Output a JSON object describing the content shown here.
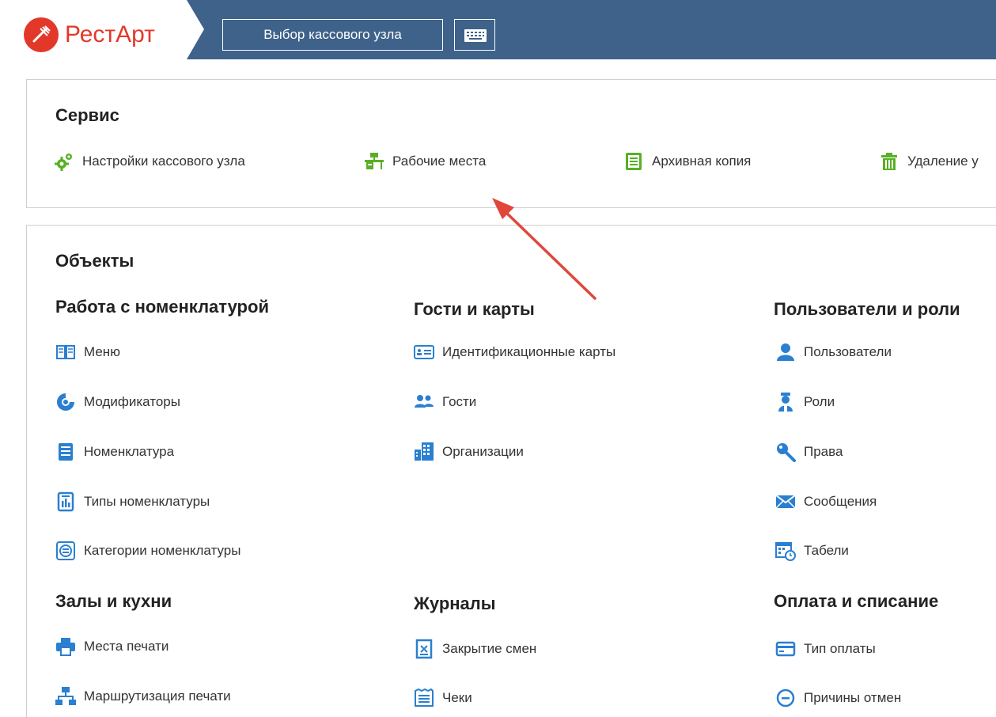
{
  "header": {
    "logo_text": "РестАрт",
    "node_button": "Выбор кассового узла",
    "keyboard_icon": "keyboard-icon",
    "background": "#3e6289",
    "brand_color": "#e2382a"
  },
  "service": {
    "title": "Сервис",
    "items": [
      {
        "label": "Настройки кассового узла",
        "icon": "gears-icon"
      },
      {
        "label": "Рабочие места",
        "icon": "workplace-icon"
      },
      {
        "label": "Архивная копия",
        "icon": "archive-icon"
      },
      {
        "label": "Удаление у",
        "icon": "trash-icon"
      }
    ],
    "icon_color": "#59b024"
  },
  "objects": {
    "title": "Объекты",
    "icon_color": "#2a7fd0",
    "groups": {
      "nomenclature": {
        "title": "Работа с номенклатурой",
        "items": [
          {
            "label": "Меню",
            "icon": "menu-book-icon"
          },
          {
            "label": "Модификаторы",
            "icon": "modifiers-icon"
          },
          {
            "label": "Номенклатура",
            "icon": "nomenclature-icon"
          },
          {
            "label": "Типы номенклатуры",
            "icon": "nomenclature-types-icon"
          },
          {
            "label": "Категории номенклатуры",
            "icon": "categories-icon"
          }
        ]
      },
      "guests": {
        "title": "Гости и карты",
        "items": [
          {
            "label": "Идентификационные карты",
            "icon": "id-card-icon"
          },
          {
            "label": "Гости",
            "icon": "guests-icon"
          },
          {
            "label": "Организации",
            "icon": "organization-icon"
          }
        ]
      },
      "users": {
        "title": "Пользователи и роли",
        "items": [
          {
            "label": "Пользователи",
            "icon": "user-icon"
          },
          {
            "label": "Роли",
            "icon": "role-icon"
          },
          {
            "label": "Права",
            "icon": "key-icon"
          },
          {
            "label": "Сообщения",
            "icon": "envelope-icon"
          },
          {
            "label": "Табели",
            "icon": "timesheet-icon"
          }
        ]
      },
      "halls": {
        "title": "Залы и кухни",
        "items": [
          {
            "label": "Места печати",
            "icon": "printer-icon"
          },
          {
            "label": "Маршрутизация печати",
            "icon": "routing-icon"
          }
        ]
      },
      "journals": {
        "title": "Журналы",
        "items": [
          {
            "label": "Закрытие смен",
            "icon": "shift-close-icon"
          },
          {
            "label": "Чеки",
            "icon": "receipts-icon"
          }
        ]
      },
      "payment": {
        "title": "Оплата и списание",
        "items": [
          {
            "label": "Тип оплаты",
            "icon": "payment-card-icon"
          },
          {
            "label": "Причины отмен",
            "icon": "cancel-reason-icon"
          }
        ]
      }
    }
  },
  "annotation": {
    "arrow_color": "#e0473a",
    "icon": "arrow-annotation"
  }
}
